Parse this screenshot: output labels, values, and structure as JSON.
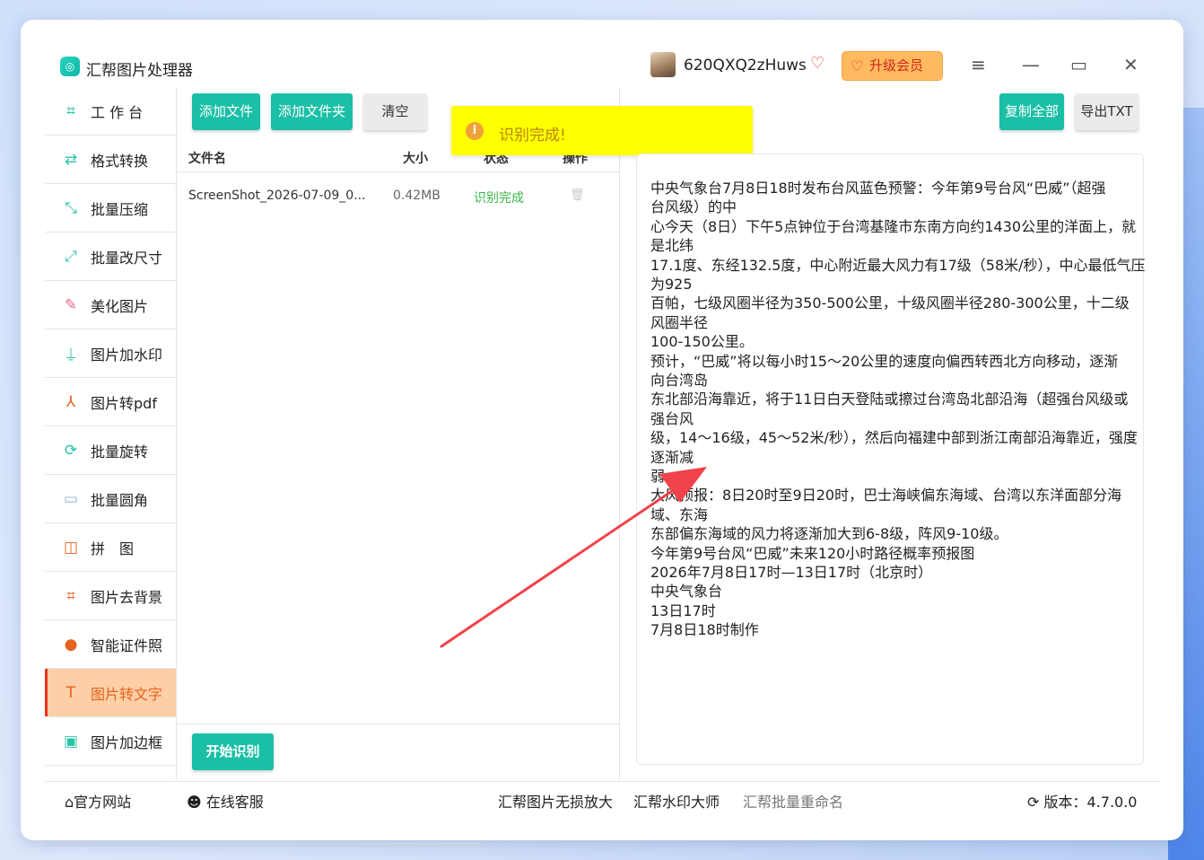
{
  "app": {
    "title": "汇帮图片处理器",
    "logo_glyph": "◎",
    "username": "620QXQ2zHuws",
    "upgrade_label": "升级会员",
    "vip_icon": "heart-gem-icon",
    "accent_color": "#1bbfa6",
    "active_color": "#e8621f"
  },
  "sidebar": {
    "items": [
      {
        "label": "工 作 台",
        "icon": "grid-icon",
        "glyph": "⌗",
        "color": "#1bbfa6"
      },
      {
        "label": "格式转换",
        "icon": "convert-icon",
        "glyph": "⇄",
        "color": "#29c3a8"
      },
      {
        "label": "批量压缩",
        "icon": "compress-icon",
        "glyph": "⤡",
        "color": "#29c3a8"
      },
      {
        "label": "批量改尺寸",
        "icon": "resize-icon",
        "glyph": "⤢",
        "color": "#3cc4c0"
      },
      {
        "label": "美化图片",
        "icon": "beautify-icon",
        "glyph": "✎",
        "color": "#e76c8a"
      },
      {
        "label": "图片加水印",
        "icon": "watermark-icon",
        "glyph": "⍊",
        "color": "#29c3a8"
      },
      {
        "label": "图片转pdf",
        "icon": "pdf-icon",
        "glyph": "⅄",
        "color": "#e8621f"
      },
      {
        "label": "批量旋转",
        "icon": "rotate-icon",
        "glyph": "⟳",
        "color": "#29c3a8"
      },
      {
        "label": "批量圆角",
        "icon": "round-corner-icon",
        "glyph": "▭",
        "color": "#8fb5d6"
      },
      {
        "label": "拼　图",
        "icon": "puzzle-icon",
        "glyph": "◫",
        "color": "#e8621f"
      },
      {
        "label": "图片去背景",
        "icon": "crop-icon",
        "glyph": "⌗",
        "color": "#e8621f"
      },
      {
        "label": "智能证件照",
        "icon": "id-photo-icon",
        "glyph": "●",
        "color": "#e8621f"
      },
      {
        "label": "图片转文字",
        "icon": "text-icon",
        "glyph": "T",
        "color": "#e8621f"
      },
      {
        "label": "图片加边框",
        "icon": "frame-icon",
        "glyph": "▣",
        "color": "#29c3a8"
      }
    ]
  },
  "toolbar": {
    "add_file": "添加文件",
    "add_folder": "添加文件夹",
    "clear": "清空",
    "copy_all": "复制全部",
    "export_txt": "导出TXT",
    "start": "开始识别"
  },
  "toast": {
    "text": "识别完成!",
    "icon_glyph": "i"
  },
  "table": {
    "headers": [
      "文件名",
      "大小",
      "状态",
      "操作"
    ],
    "rows": [
      {
        "name": "ScreenShot_2026-07-09_0...",
        "size": "0.42MB",
        "status": "识别完成",
        "action_icon": "trash-icon"
      }
    ],
    "status_color": "#3bb54a"
  },
  "result": {
    "lines": [
      "中央气象台7月8日18时发布台风蓝色预警：今年第9号台风“巴威”（超强",
      "台风级）的中",
      "心今天（8日）下午5点钟位于台湾基隆市东南方向约1430公里的洋面上，就",
      "是北纬",
      "17.1度、东经132.5度，中心附近最大风力有17级（58米/秒），中心最低气压",
      "为925",
      "百帕，七级风圈半径为350-500公里，十级风圈半径280-300公里，十二级",
      "风圈半径",
      "100-150公里。",
      "预计，“巴威”将以每小时15～20公里的速度向偏西转西北方向移动，逐渐",
      "向台湾岛",
      "东北部沿海靠近，将于11日白天登陆或擦过台湾岛北部沿海（超强台风级或",
      "强台风",
      "级，14～16级，45～52米/秒），然后向福建中部到浙江南部沿海靠近，强度",
      "逐渐减",
      "弱。",
      "大风预报：8日20时至9日20时，巴士海峡偏东海域、台湾以东洋面部分海",
      "域、东海",
      "东部偏东海域的风力将逐渐加大到6-8级，阵风9-10级。",
      "今年第9号台风“巴威”未来120小时路径概率预报图",
      "2026年7月8日17时—13日17时（北京时）",
      "中央气象台",
      "13日17时",
      "7月8日18时制作"
    ]
  },
  "footer": {
    "website": "官方网站",
    "service": "在线客服",
    "link1": "汇帮图片无损放大",
    "link2": "汇帮水印大师",
    "link3": "汇帮批量重命名",
    "version": "版本：4.7.0.0"
  }
}
